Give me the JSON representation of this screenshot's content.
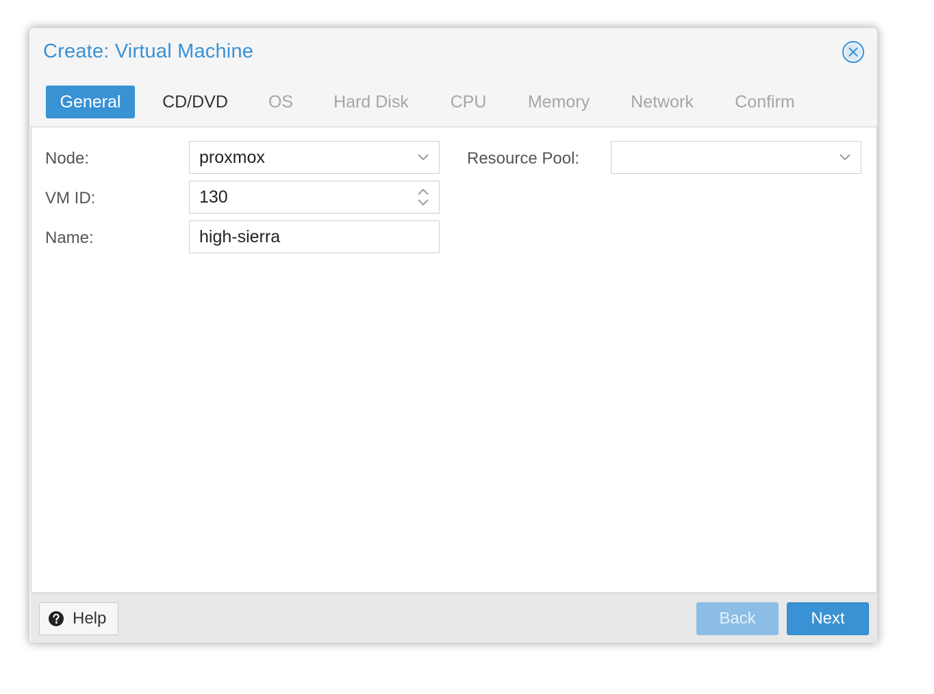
{
  "dialog": {
    "title": "Create: Virtual Machine",
    "accent_color": "#3892d4"
  },
  "tabs": [
    {
      "label": "General",
      "state": "active"
    },
    {
      "label": "CD/DVD",
      "state": "enabled"
    },
    {
      "label": "OS",
      "state": "disabled"
    },
    {
      "label": "Hard Disk",
      "state": "disabled"
    },
    {
      "label": "CPU",
      "state": "disabled"
    },
    {
      "label": "Memory",
      "state": "disabled"
    },
    {
      "label": "Network",
      "state": "disabled"
    },
    {
      "label": "Confirm",
      "state": "disabled"
    }
  ],
  "form": {
    "node": {
      "label": "Node:",
      "value": "proxmox",
      "icon": "chevron-down-icon"
    },
    "vmid": {
      "label": "VM ID:",
      "value": "130",
      "icon": "spinner-icon"
    },
    "name": {
      "label": "Name:",
      "value": "high-sierra"
    },
    "pool": {
      "label": "Resource Pool:",
      "value": "",
      "icon": "chevron-down-icon"
    }
  },
  "footer": {
    "help_label": "Help",
    "back_label": "Back",
    "next_label": "Next",
    "back_enabled": false
  },
  "icons": {
    "close": "close-icon",
    "help": "question-circle-icon"
  }
}
